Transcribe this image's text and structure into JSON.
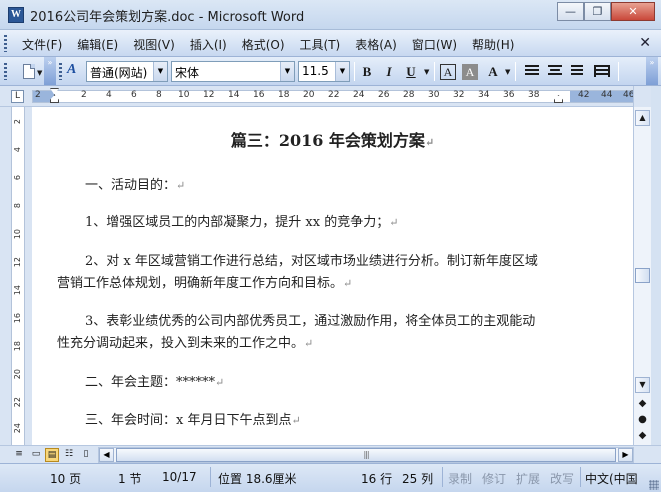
{
  "window": {
    "title": "2016公司年会策划方案.doc - Microsoft Word",
    "app_icon_letter": "W",
    "minimize_glyph": "—",
    "maximize_glyph": "❐",
    "close_glyph": "✕"
  },
  "menu": {
    "items": [
      "文件(F)",
      "编辑(E)",
      "视图(V)",
      "插入(I)",
      "格式(O)",
      "工具(T)",
      "表格(A)",
      "窗口(W)",
      "帮助(H)"
    ],
    "close_glyph": "✕"
  },
  "toolbar": {
    "style_value": "普通(网站)",
    "font_value": "宋体",
    "size_value": "11.5",
    "bold": "B",
    "italic": "I",
    "underline": "U",
    "border_char": "A",
    "shade_char": "A",
    "highlight_char": "A",
    "styles_icon_text": "A",
    "dropdown_glyph": "▼",
    "chevron": "»"
  },
  "ruler": {
    "corner_glyph": "L",
    "numbers": [
      "2",
      "2",
      "4",
      "6",
      "8",
      "10",
      "12",
      "14",
      "16",
      "18",
      "20",
      "22",
      "24",
      "26",
      "28",
      "30",
      "32",
      "34",
      "36",
      "38",
      "42",
      "44",
      "46"
    ]
  },
  "vruler": {
    "numbers": [
      "2",
      "4",
      "6",
      "8",
      "10",
      "12",
      "14",
      "16",
      "18",
      "20",
      "22",
      "24"
    ]
  },
  "document": {
    "title": "篇三：2016 年会策划方案",
    "para_mark": "↵",
    "paragraphs": [
      {
        "lines": [
          "一、活动目的："
        ]
      },
      {
        "lines": [
          "1、增强区域员工的内部凝聚力，提升 xx 的竞争力；"
        ]
      },
      {
        "lines": [
          "2、对 x 年区域营销工作进行总结，对区域市场业绩进行分析。制订新年度区域",
          "营销工作总体规划，明确新年度工作方向和目标。"
        ]
      },
      {
        "lines": [
          "3、表彰业绩优秀的公司内部优秀员工，通过激励作用，将全体员工的主观能动",
          "性充分调动起来，投入到未来的工作之中。"
        ]
      },
      {
        "lines": [
          "二、年会主题：******"
        ]
      },
      {
        "lines": [
          "三、年会时间：x 年月日下午点到点"
        ]
      }
    ]
  },
  "scrollbar": {
    "up_glyph": "▲",
    "down_glyph": "▼",
    "prev_glyph": "◆",
    "browse_glyph": "●",
    "next_glyph": "◆",
    "left_glyph": "◀",
    "right_glyph": "▶",
    "thumb_grip": "|||"
  },
  "statusbar": {
    "page": "10 页",
    "section": "1 节",
    "pages": "10/17",
    "position": "位置 18.6厘米",
    "line": "16 行",
    "column": "25 列",
    "rec": "录制",
    "trk": "修订",
    "ext": "扩展",
    "ovr": "改写",
    "language": "中文(中国"
  }
}
